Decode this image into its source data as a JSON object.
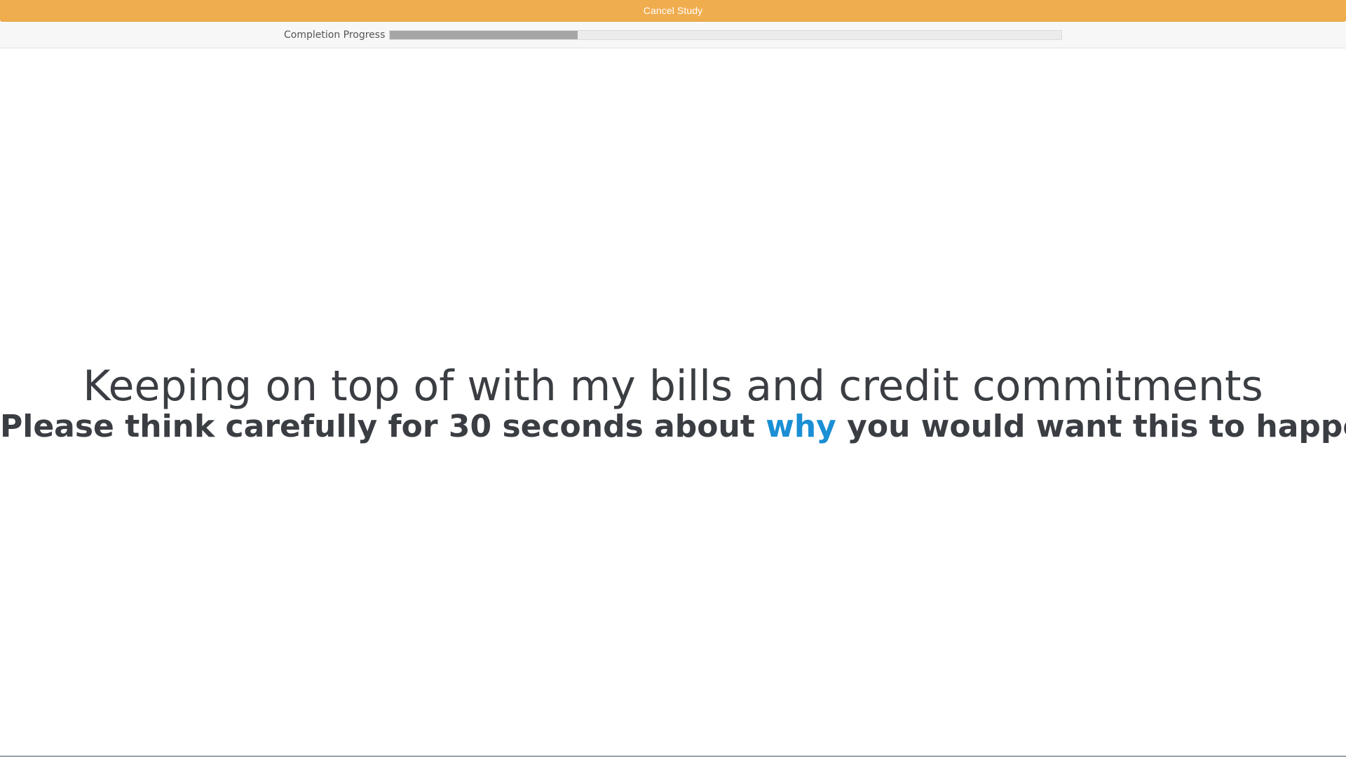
{
  "header": {
    "cancel_label": "Cancel Study",
    "button_color": "#f0ad4e"
  },
  "progress": {
    "label": "Completion Progress",
    "value_fraction": 0.28
  },
  "main": {
    "statement": "Keeping on top of with my bills and credit commitments",
    "instruction_before": "Please think carefully for 30 seconds about ",
    "instruction_highlight": "why",
    "instruction_after": " you would want this to happen",
    "highlight_color": "#1a8fd5",
    "text_color": "#3a3d42"
  }
}
